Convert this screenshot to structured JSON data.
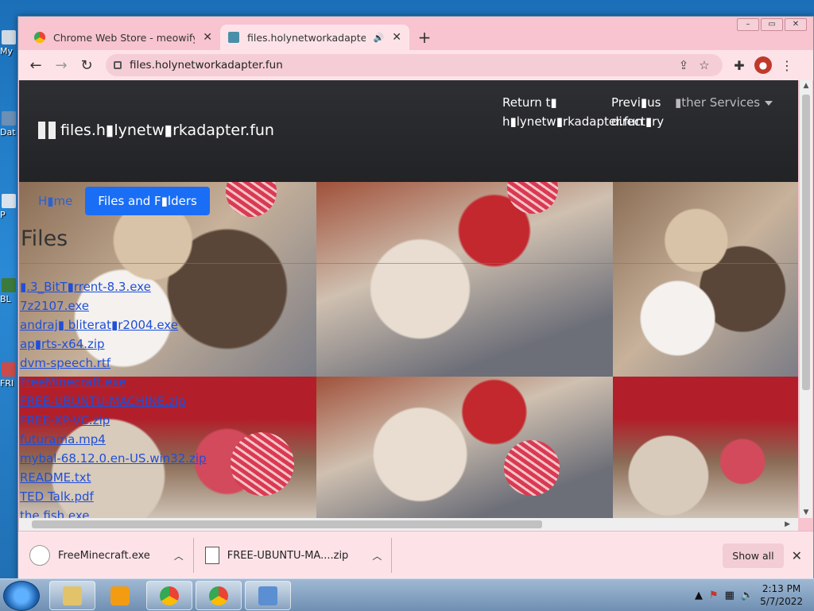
{
  "desktop": {
    "icons": [
      "My",
      "Dat",
      "P",
      "BL",
      "FRI"
    ]
  },
  "browser": {
    "tabs": [
      {
        "title": "Chrome Web Store - meowify",
        "active": false
      },
      {
        "title": "files.holynetworkadapter.fun",
        "active": true,
        "audio": true
      }
    ],
    "url": "files.holynetworkadapter.fun"
  },
  "site": {
    "brand": "files.h▮lynetw▮rkadapter.fun",
    "nav": {
      "return_home": "Return t▮ h▮lynetw▮rkadapter.fun",
      "previous": "Previ▮us direct▮ry",
      "other_services": "▮ther Services"
    },
    "breadcrumb": {
      "home": "H▮me",
      "current": "Files and F▮lders"
    },
    "heading": "Files",
    "files": [
      "▮.3_BitT▮rrent-8.3.exe",
      "7z2107.exe",
      "andraj▮ bliterat▮r2004.exe",
      "ap▮rts-x64.zip",
      "dvm-speech.rtf",
      "FreeMinecraft.exe",
      "FREE-UBUNTU-MACHINE.zip",
      "FREE-XP-VC.zip",
      "futurama.mp4",
      "mybal-68.12.0.en-US.win32.zip",
      "README.txt",
      "TED Talk.pdf",
      "the fish.exe"
    ]
  },
  "downloads": {
    "items": [
      {
        "name": "FreeMinecraft.exe"
      },
      {
        "name": "FREE-UBUNTU-MA....zip"
      }
    ],
    "show_all": "Show all"
  },
  "taskbar": {
    "time": "2:13 PM",
    "date": "5/7/2022"
  },
  "colors": {
    "window_frame": "#f7c4d0",
    "toolbar": "#fde3e8",
    "link": "#1f4fd8",
    "active_crumb": "#1a6ef5",
    "header_dark": "#2e2f33"
  }
}
